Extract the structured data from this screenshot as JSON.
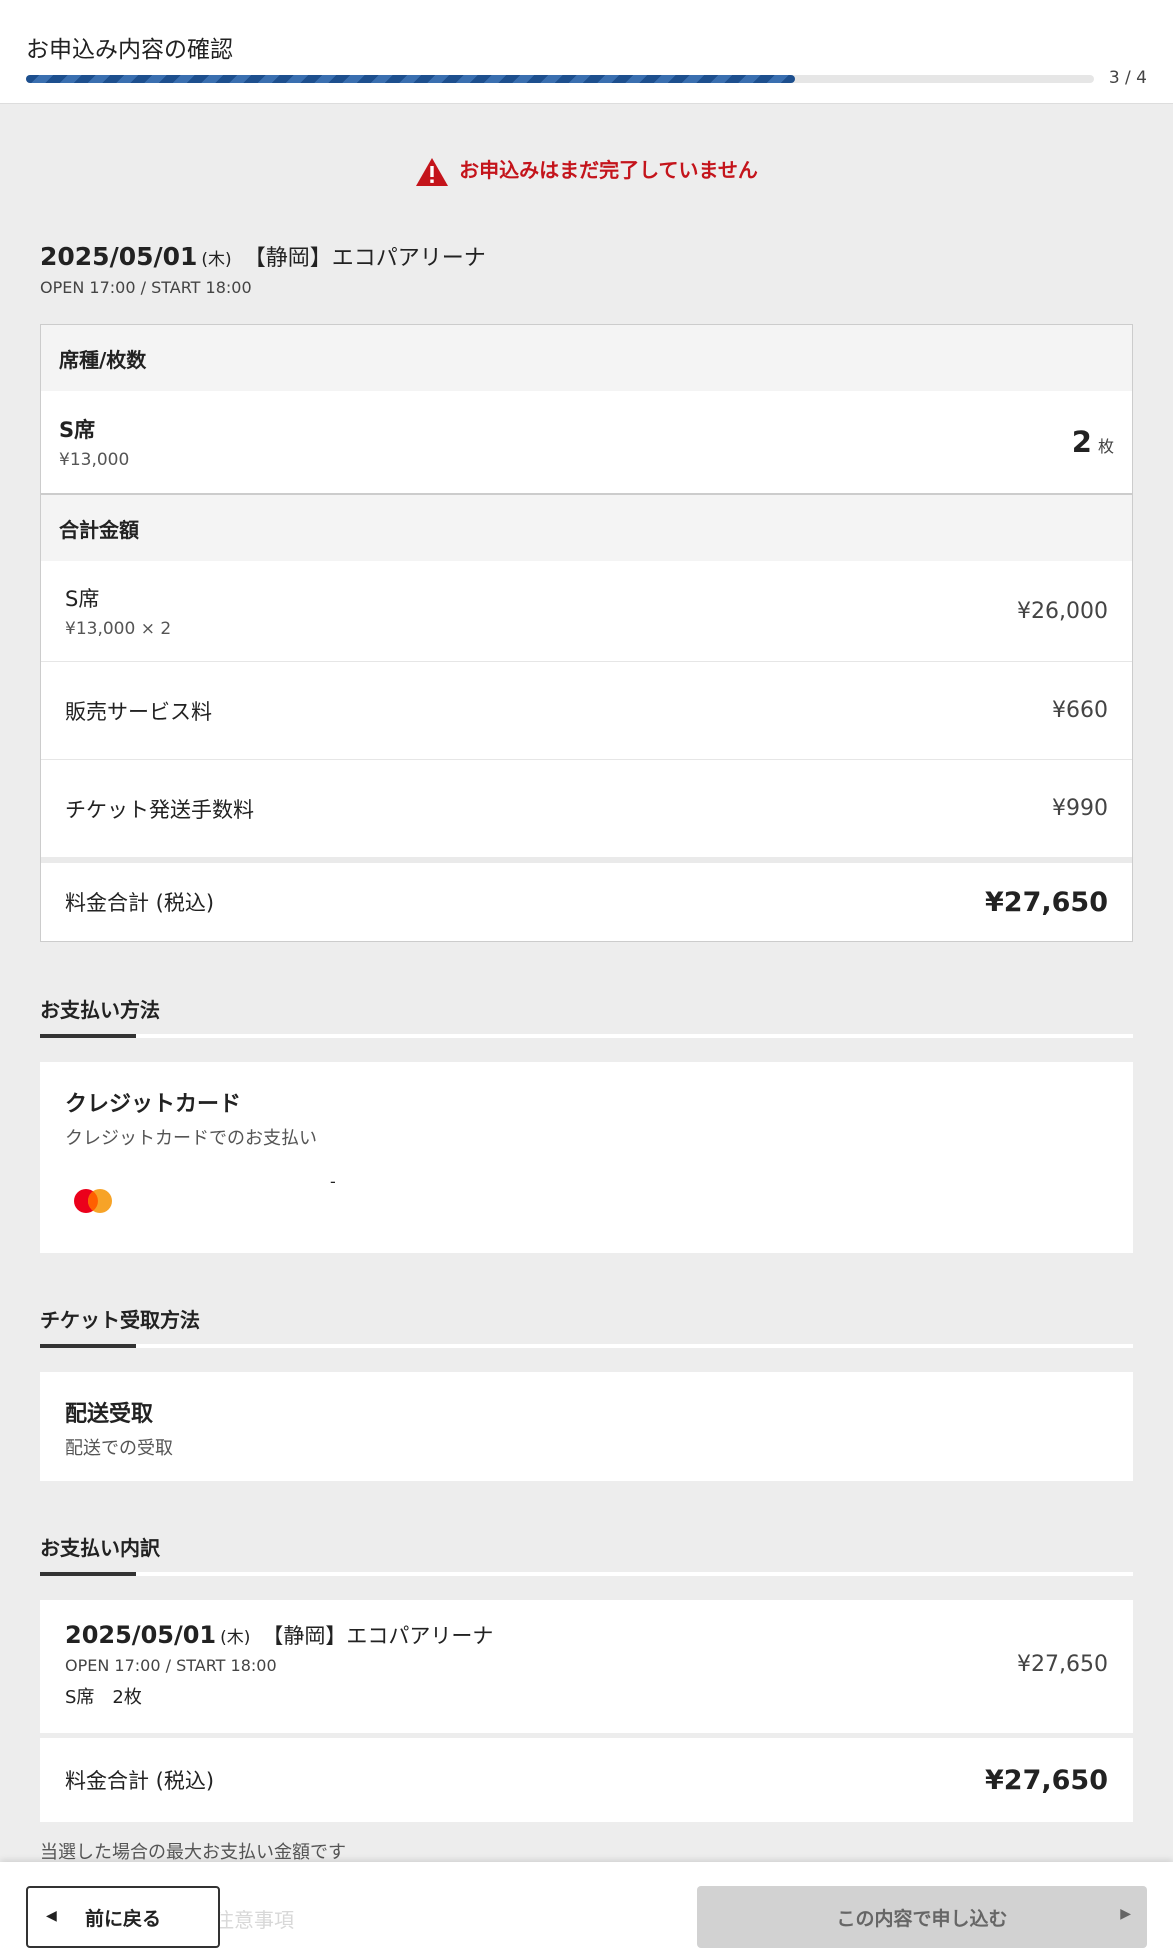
{
  "header": {
    "title": "お申込み内容の確認",
    "step": "3 / 4",
    "progress": 0.72
  },
  "warning": {
    "text": "お申込みはまだ完了していません"
  },
  "event": {
    "date": "2025/05/01",
    "dow": "(木)",
    "venue": "【静岡】エコパアリーナ",
    "time": "OPEN 17:00  /  START 18:00"
  },
  "seats": {
    "header": "席種/枚数",
    "name": "S席",
    "price": "¥13,000",
    "qty": "2",
    "unit": "枚"
  },
  "total": {
    "header": "合計金額",
    "rows": [
      {
        "label": "S席",
        "sub": "¥13,000 × 2",
        "amount": "¥26,000"
      },
      {
        "label": "販売サービス料",
        "amount": "¥660"
      },
      {
        "label": "チケット発送手数料",
        "amount": "¥990"
      }
    ],
    "grand_label": "料金合計 (税込)",
    "grand_amount": "¥27,650"
  },
  "payment": {
    "section": "お支払い方法",
    "title": "クレジットカード",
    "sub": "クレジットカードでのお支払い",
    "card_number": "-"
  },
  "delivery": {
    "section": "チケット受取方法",
    "title": "配送受取",
    "sub": "配送での受取"
  },
  "breakdown": {
    "section": "お支払い内訳",
    "date": "2025/05/01",
    "dow": "(木)",
    "venue": "【静岡】エコパアリーナ",
    "time": "OPEN 17:00  /  START 18:00",
    "seats": "S席　2枚",
    "amount": "¥27,650",
    "grand_label": "料金合計 (税込)",
    "grand_amount": "¥27,650",
    "note": "当選した場合の最大お支払い金額です"
  },
  "footer": {
    "back": "前に戻る",
    "submit": "この内容で申し込む",
    "hidden_text": "注意事項"
  },
  "colors": {
    "accent": "#1d4f8e",
    "warning": "#c4141b",
    "mastercard_red": "#eb001b",
    "mastercard_orange": "#f79e1b"
  }
}
